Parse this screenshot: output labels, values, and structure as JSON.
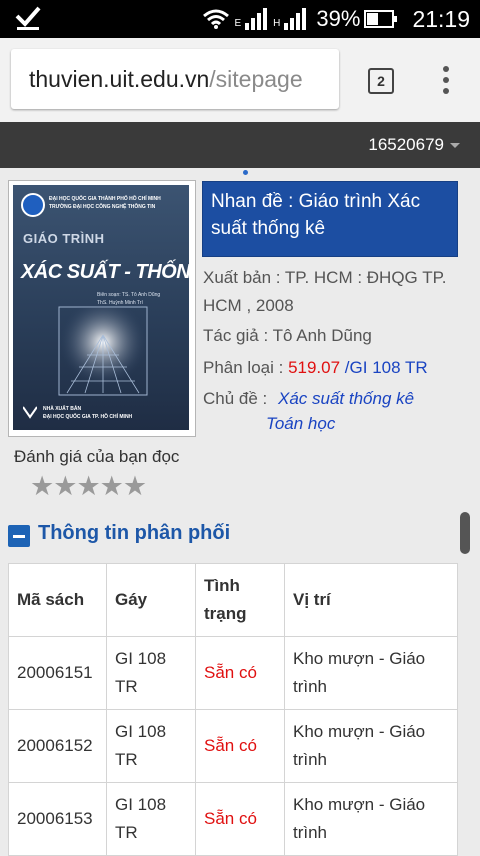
{
  "status_bar": {
    "network_e": "E",
    "network_h": "H",
    "battery_pct": "39%",
    "time": "21:19"
  },
  "browser": {
    "url_domain": "thuvien.uit.edu.vn",
    "url_path": "/sitepage",
    "tab_count": "2"
  },
  "site_header": {
    "user_id": "16520679"
  },
  "book": {
    "cover_text": {
      "university_line1": "ĐẠI HỌC QUỐC GIA THÀNH PHỐ HỒ CHÍ MINH",
      "university_line2": "TRƯỜNG ĐẠI HỌC CÔNG NGHỆ THÔNG TIN",
      "uit": "UIT",
      "series": "GIÁO TRÌNH",
      "title": "XÁC SUẤT - THỐNG KÊ",
      "author_line1": "Biên soạn: TS. Tô Anh Dũng",
      "author_line2": "ThS. Huỳnh Minh Trí",
      "publisher_line1": "NHÀ XUẤT BẢN",
      "publisher_line2": "ĐẠI HỌC QUỐC GIA TP. HỒ CHÍ MINH"
    },
    "title_label": "Nhan đề : Giáo trình Xác suất thống kê",
    "publish_label": "Xuất bản : ",
    "publish_value": "TP. HCM : ĐHQG TP. HCM , 2008",
    "author_label": "Tác giả : ",
    "author_value": "Tô Anh Dũng",
    "class_label": "Phân loại : ",
    "class_code": "519.07",
    "class_call": "/GI 108 TR",
    "subject_label": "Chủ đề : ",
    "subjects": [
      "Xác suất thống kê",
      "Toán học"
    ],
    "rating_label": "Đánh giá của bạn đọc",
    "rating_stars": 0,
    "rating_max": 5
  },
  "distribution": {
    "section_title": "Thông tin phân phối",
    "headers": [
      "Mã sách",
      "Gáy",
      "Tình trạng",
      "Vị trí"
    ],
    "rows": [
      {
        "id": "20006151",
        "call": "GI 108 TR",
        "status": "Sẵn có",
        "location": "Kho mượn - Giáo trình"
      },
      {
        "id": "20006152",
        "call": "GI 108 TR",
        "status": "Sẵn có",
        "location": "Kho mượn - Giáo trình"
      },
      {
        "id": "20006153",
        "call": "GI 108 TR",
        "status": "Sẵn có",
        "location": "Kho mượn - Giáo trình"
      }
    ]
  },
  "colors": {
    "title_box": "#1c4ea2",
    "link_blue": "#1a44c2",
    "status_red": "#e01010",
    "header_dark": "#3a3a3a"
  }
}
